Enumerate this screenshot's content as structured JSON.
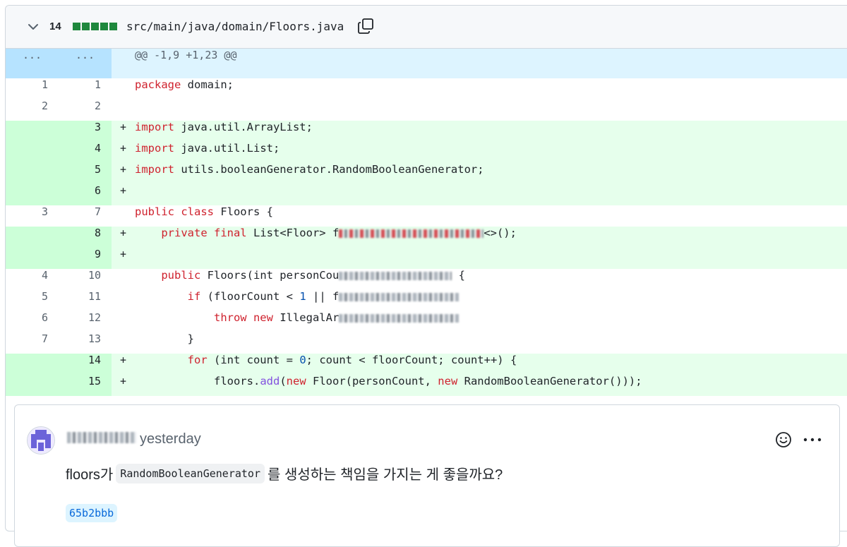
{
  "file": {
    "change_count": "14",
    "path": "src/main/java/domain/Floors.java"
  },
  "hunk": {
    "old_label": "...",
    "new_label": "...",
    "header": "@@ -1,9 +1,23 @@"
  },
  "lines": [
    {
      "old": "1",
      "new": "1",
      "type": "ctx",
      "marker": "",
      "code": "package domain;"
    },
    {
      "old": "2",
      "new": "2",
      "type": "ctx",
      "marker": "",
      "code": ""
    },
    {
      "old": "",
      "new": "3",
      "type": "add",
      "marker": "+",
      "code": "import java.util.ArrayList;"
    },
    {
      "old": "",
      "new": "4",
      "type": "add",
      "marker": "+",
      "code": "import java.util.List;"
    },
    {
      "old": "",
      "new": "5",
      "type": "add",
      "marker": "+",
      "code": "import utils.booleanGenerator.RandomBooleanGenerator;"
    },
    {
      "old": "",
      "new": "6",
      "type": "add",
      "marker": "+",
      "code": ""
    },
    {
      "old": "3",
      "new": "7",
      "type": "ctx",
      "marker": "",
      "code": "public class Floors {"
    },
    {
      "old": "",
      "new": "8",
      "type": "add",
      "marker": "+",
      "code": "    private final List<Floor> f…<>();"
    },
    {
      "old": "",
      "new": "9",
      "type": "add",
      "marker": "+",
      "code": ""
    },
    {
      "old": "4",
      "new": "10",
      "type": "ctx",
      "marker": "",
      "code": "    public Floors(int personCou… {"
    },
    {
      "old": "5",
      "new": "11",
      "type": "ctx",
      "marker": "",
      "code": "        if (floorCount < 1 || f…"
    },
    {
      "old": "6",
      "new": "12",
      "type": "ctx",
      "marker": "",
      "code": "            throw new IllegalAr…"
    },
    {
      "old": "7",
      "new": "13",
      "type": "ctx",
      "marker": "",
      "code": "        }"
    },
    {
      "old": "",
      "new": "14",
      "type": "add",
      "marker": "+",
      "code": "        for (int count = 0; count < floorCount; count++) {"
    },
    {
      "old": "",
      "new": "15",
      "type": "add",
      "marker": "+",
      "code": "            floors.add(new Floor(personCount, new RandomBooleanGenerator()));"
    }
  ],
  "comment": {
    "time": "yesterday",
    "text_before": "floors가",
    "inline_code": "RandomBooleanGenerator",
    "text_after": "를 생성하는 책임을 가지는 게 좋을까요?",
    "commit": "65b2bbb"
  },
  "colors": {
    "added_bg": "#e6ffec",
    "added_gutter": "#ccffd8",
    "hunk_bg": "#ddf4ff",
    "keyword": "#cf222e",
    "number": "#0550ae",
    "method": "#8250df",
    "diffstat_green": "#1f883d"
  },
  "icons": {
    "collapse": "chevron-down-icon",
    "copy": "copy-icon",
    "emoji": "smiley-icon",
    "more": "kebab-horizontal-icon"
  }
}
